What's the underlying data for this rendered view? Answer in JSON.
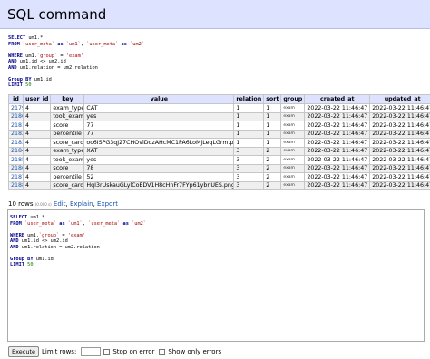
{
  "header": {
    "title": "SQL command"
  },
  "query_lines": [
    [
      [
        "kw",
        "SELECT"
      ],
      [
        "t",
        " um1.*"
      ]
    ],
    [
      [
        "kw",
        "FROM"
      ],
      [
        "t",
        " "
      ],
      [
        "str",
        "`user_meta`"
      ],
      [
        "t",
        " "
      ],
      [
        "kw",
        "as"
      ],
      [
        "t",
        " "
      ],
      [
        "str",
        "`um1`"
      ],
      [
        "t",
        ", "
      ],
      [
        "str",
        "`user_meta`"
      ],
      [
        "t",
        " "
      ],
      [
        "kw",
        "as"
      ],
      [
        "t",
        " "
      ],
      [
        "str",
        "`um2`"
      ]
    ],
    [
      [
        "t",
        ""
      ]
    ],
    [
      [
        "kw",
        "WHERE"
      ],
      [
        "t",
        " um1."
      ],
      [
        "str",
        "`group`"
      ],
      [
        "t",
        " = "
      ],
      [
        "str",
        "'exam'"
      ]
    ],
    [
      [
        "kw",
        "AND"
      ],
      [
        "t",
        " um1.id <> um2.id"
      ]
    ],
    [
      [
        "kw",
        "AND"
      ],
      [
        "t",
        " um1.relation = um2.relation"
      ]
    ],
    [
      [
        "t",
        ""
      ]
    ],
    [
      [
        "kw",
        "Group BY"
      ],
      [
        "t",
        " um1.id"
      ]
    ],
    [
      [
        "kw",
        "LIMIT"
      ],
      [
        "t",
        " "
      ],
      [
        "num",
        "50"
      ]
    ]
  ],
  "table": {
    "headers": [
      "id",
      "user_id",
      "key",
      "value",
      "relation",
      "sort",
      "group",
      "created_at",
      "updated_at"
    ],
    "rows": [
      [
        "2179",
        "4",
        "exam_type",
        "CAT",
        "1",
        "1",
        "exam",
        "2022-03-22 11:46:47",
        "2022-03-22 11:46:47"
      ],
      [
        "2180",
        "4",
        "took_exam",
        "yes",
        "1",
        "1",
        "exam",
        "2022-03-22 11:46:47",
        "2022-03-22 11:46:47"
      ],
      [
        "2181",
        "4",
        "score",
        "77",
        "1",
        "1",
        "exam",
        "2022-03-22 11:46:47",
        "2022-03-22 11:46:47"
      ],
      [
        "2182",
        "4",
        "percentile",
        "77",
        "1",
        "1",
        "exam",
        "2022-03-22 11:46:47",
        "2022-03-22 11:46:47"
      ],
      [
        "2183",
        "4",
        "score_card",
        "oc6ISPG3qJ27CHOvlDozAHcMC1PA6LoMjLeqLGrm.png",
        "1",
        "1",
        "exam",
        "2022-03-22 11:46:47",
        "2022-03-22 11:46:47"
      ],
      [
        "2184",
        "4",
        "exam_type",
        "XAT",
        "3",
        "2",
        "exam",
        "2022-03-22 11:46:47",
        "2022-03-22 11:46:47"
      ],
      [
        "2185",
        "4",
        "took_exam",
        "yes",
        "3",
        "2",
        "exam",
        "2022-03-22 11:46:47",
        "2022-03-22 11:46:47"
      ],
      [
        "2186",
        "4",
        "score",
        "78",
        "3",
        "2",
        "exam",
        "2022-03-22 11:46:47",
        "2022-03-22 11:46:47"
      ],
      [
        "2187",
        "4",
        "percentile",
        "52",
        "3",
        "2",
        "exam",
        "2022-03-22 11:46:47",
        "2022-03-22 11:46:47"
      ],
      [
        "2188",
        "4",
        "score_card",
        "HqI3rUskauGLylCoEDV1H8cHnFr7FYp61ybnUES.png",
        "3",
        "2",
        "exam",
        "2022-03-22 11:46:47",
        "2022-03-22 11:46:47"
      ]
    ]
  },
  "result": {
    "rows_count": "10 rows",
    "time": "(0.000 s)",
    "edit": "Edit",
    "explain": "Explain",
    "export": "Export",
    "sep1": ",",
    "sep2": ","
  },
  "bottom": {
    "execute": "Execute",
    "limit_label": "Limit rows:",
    "limit_value": "",
    "stop_label": "Stop on error",
    "errors_label": "Show only errors"
  }
}
